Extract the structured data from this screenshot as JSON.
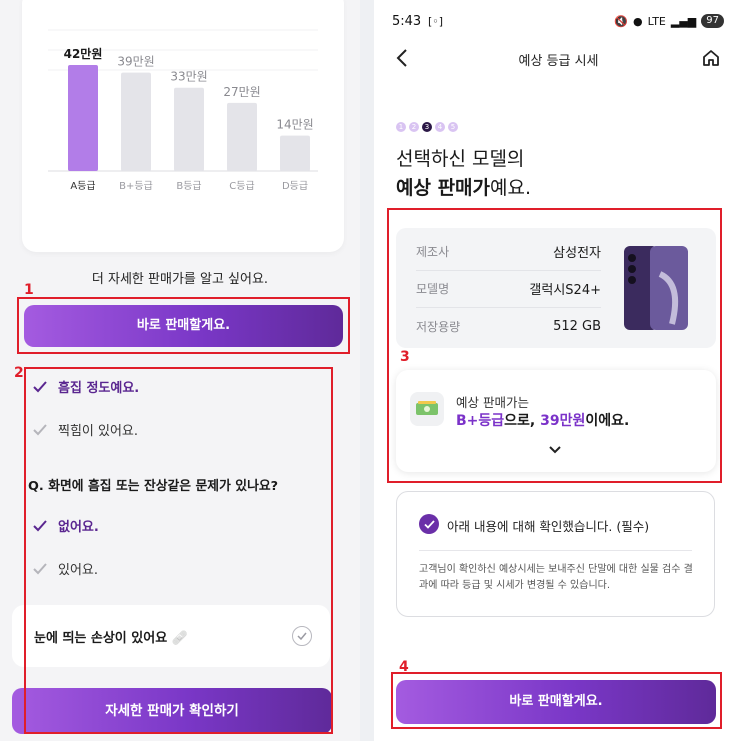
{
  "left": {
    "chart_data": {
      "type": "bar",
      "categories": [
        "A등급",
        "B+등급",
        "B등급",
        "C등급",
        "D등급"
      ],
      "values": [
        42,
        39,
        33,
        27,
        14
      ],
      "value_labels": [
        "42만원",
        "39만원",
        "33만원",
        "27만원",
        "14만원"
      ],
      "highlight_index": 0,
      "colors": {
        "highlight": "#b27de8",
        "normal": "#e4e4e9"
      }
    },
    "ask_text": "더 자세한 판매가를 알고 싶어요.",
    "sell_button": "바로 판매할게요.",
    "options_group1": [
      {
        "label": "흠집 정도예요.",
        "selected": true
      },
      {
        "label": "찍힘이 있어요.",
        "selected": false
      }
    ],
    "question": "Q. 화면에 흠집 또는 잔상같은 문제가 있나요?",
    "options_group2": [
      {
        "label": "없어요.",
        "selected": true
      },
      {
        "label": "있어요.",
        "selected": false
      }
    ],
    "damage_card": "눈에 띄는 손상이 있어요 🩹",
    "detail_button": "자세한 판매가 확인하기"
  },
  "right": {
    "status": {
      "time": "5:43",
      "battery": "97",
      "network": "LTE"
    },
    "nav_title": "예상 등급 시세",
    "steps": [
      "1",
      "2",
      "3",
      "4",
      "5"
    ],
    "current_step": 3,
    "headline": {
      "line1": "선택하신 모델의",
      "bold": "예상 판매가",
      "rest": "예요."
    },
    "info": [
      {
        "key": "제조사",
        "value": "삼성전자"
      },
      {
        "key": "모델명",
        "value": "갤럭시S24+"
      },
      {
        "key": "저장용량",
        "value": "512 GB"
      }
    ],
    "estimate": {
      "line1": "예상 판매가는",
      "grade": "B+등급",
      "mid": "으로, ",
      "price": "39만원",
      "end": "이에요."
    },
    "confirm": {
      "title": "아래 내용에 대해 확인했습니다. (필수)",
      "note": "고객님이 확인하신 예상시세는 보내주신 단말에 대한 실물 검수 결과에 따라 등급 및 시세가 변경될 수 있습니다."
    },
    "sell_button": "바로 판매할게요."
  },
  "annotations": [
    "1",
    "2",
    "3",
    "4"
  ],
  "colors": {
    "accent": "#7b32c9",
    "annotation": "#e01e2a"
  }
}
